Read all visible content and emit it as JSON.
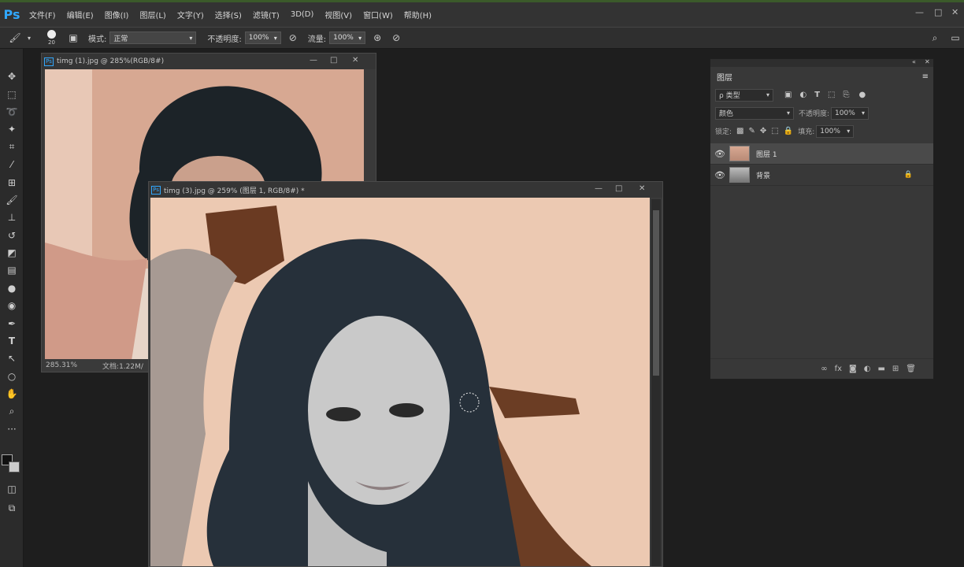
{
  "app": {
    "logo": "Ps"
  },
  "menu": [
    "文件(F)",
    "编辑(E)",
    "图像(I)",
    "图层(L)",
    "文字(Y)",
    "选择(S)",
    "滤镜(T)",
    "3D(D)",
    "视图(V)",
    "窗口(W)",
    "帮助(H)"
  ],
  "options": {
    "brush_size": "20",
    "mode_label": "模式:",
    "mode_value": "正常",
    "opacity_label": "不透明度:",
    "opacity_value": "100%",
    "flow_label": "流量:",
    "flow_value": "100%"
  },
  "doc1": {
    "title": "timg (1).jpg @ 285%(RGB/8#)",
    "zoom": "285.31%",
    "doc_info": "文档:1.22M/"
  },
  "doc2": {
    "title": "timg (3).jpg @ 259% (图层 1, RGB/8#) *"
  },
  "layers_panel": {
    "tab": "图层",
    "filter_kind": "ρ 类型",
    "blend_mode": "颜色",
    "opacity_label": "不透明度:",
    "opacity_value": "100%",
    "lock_label": "锁定:",
    "fill_label": "填充:",
    "fill_value": "100%",
    "layers": [
      {
        "name": "图层 1",
        "active": true
      },
      {
        "name": "背景",
        "active": false
      }
    ]
  }
}
